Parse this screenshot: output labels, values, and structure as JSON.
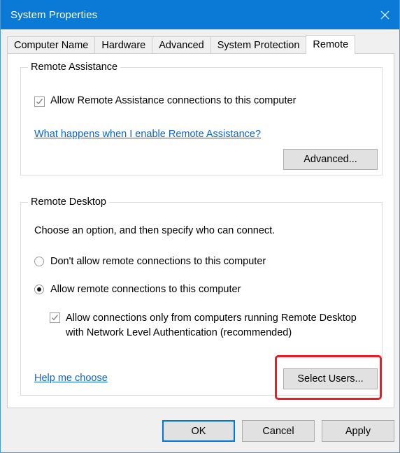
{
  "window": {
    "title": "System Properties",
    "close_icon": "close-icon"
  },
  "tabs": [
    {
      "label": "Computer Name",
      "active": false
    },
    {
      "label": "Hardware",
      "active": false
    },
    {
      "label": "Advanced",
      "active": false
    },
    {
      "label": "System Protection",
      "active": false
    },
    {
      "label": "Remote",
      "active": true
    }
  ],
  "remote_assistance": {
    "group_title": "Remote Assistance",
    "allow_checkbox_label": "Allow Remote Assistance connections to this computer",
    "allow_checkbox_checked": true,
    "help_link": "What happens when I enable Remote Assistance?",
    "advanced_button": "Advanced..."
  },
  "remote_desktop": {
    "group_title": "Remote Desktop",
    "instruction": "Choose an option, and then specify who can connect.",
    "options": [
      {
        "label": "Don't allow remote connections to this computer",
        "selected": false
      },
      {
        "label": "Allow remote connections to this computer",
        "selected": true
      }
    ],
    "nla_checkbox_line1": "Allow connections only from computers running Remote Desktop",
    "nla_checkbox_line2": "with Network Level Authentication (recommended)",
    "nla_checkbox_checked": true,
    "help_link": "Help me choose",
    "select_users_button": "Select Users..."
  },
  "footer": {
    "ok_label": "OK",
    "cancel_label": "Cancel",
    "apply_label": "Apply"
  },
  "colors": {
    "titlebar": "#0b7ad6",
    "accent": "#0078d7",
    "link": "#0b64d0",
    "highlight": "#ee1b24",
    "button_face": "#e1e1e1"
  }
}
